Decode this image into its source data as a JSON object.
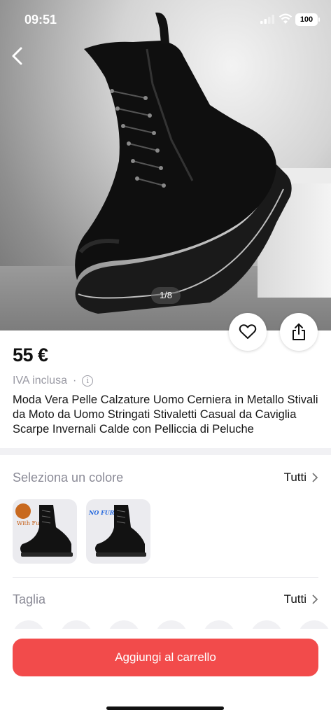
{
  "status_bar": {
    "time": "09:51",
    "battery": "100"
  },
  "gallery": {
    "counter": "1/8"
  },
  "product": {
    "price": "55 €",
    "vat_label": "IVA inclusa",
    "vat_separator": "·",
    "title": "Moda Vera Pelle Calzature Uomo Cerniera in Metallo Stivali da Moto da Uomo Stringati Stivaletti Casual da Caviglia Scarpe Invernali Calde con Pelliccia di Peluche"
  },
  "color_section": {
    "label": "Seleziona un colore",
    "all_label": "Tutti",
    "options": [
      {
        "badge_text": "With Fur"
      },
      {
        "badge_text": "NO FUR"
      }
    ]
  },
  "size_section": {
    "label": "Taglia",
    "all_label": "Tutti"
  },
  "cta": {
    "add_to_cart": "Aggiungi al carrello"
  },
  "colors": {
    "accent": "#f24b4b",
    "muted_text": "#8a8a96"
  },
  "icons": [
    "back-arrow-icon",
    "heart-icon",
    "share-icon",
    "info-icon",
    "chevron-right-icon",
    "signal-icon",
    "wifi-icon",
    "battery-icon"
  ]
}
